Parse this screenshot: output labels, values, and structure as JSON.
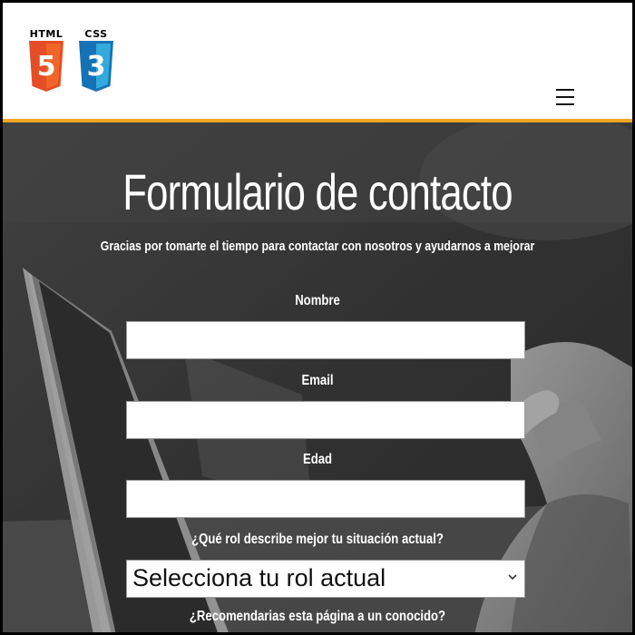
{
  "header": {
    "logo_html_label": "HTML",
    "logo_html_number": "5",
    "logo_css_label": "CSS",
    "logo_css_number": "3",
    "accent_color": "#f5a623",
    "html_color": "#e44d26",
    "css_color": "#1572b6",
    "menu_icon": "hamburger-menu-icon"
  },
  "form": {
    "title": "Formulario de contacto",
    "subtitle": "Gracias por tomarte el tiempo para contactar con nosotros y ayudarnos a mejorar",
    "name_label": "Nombre",
    "name_value": "",
    "email_label": "Email",
    "email_value": "",
    "age_label": "Edad",
    "age_value": "",
    "role_question": "¿Qué rol describe mejor tu situación actual?",
    "role_selected": "Selecciona tu rol actual",
    "recommend_question": "¿Recomendarias esta página a un conocido?"
  }
}
